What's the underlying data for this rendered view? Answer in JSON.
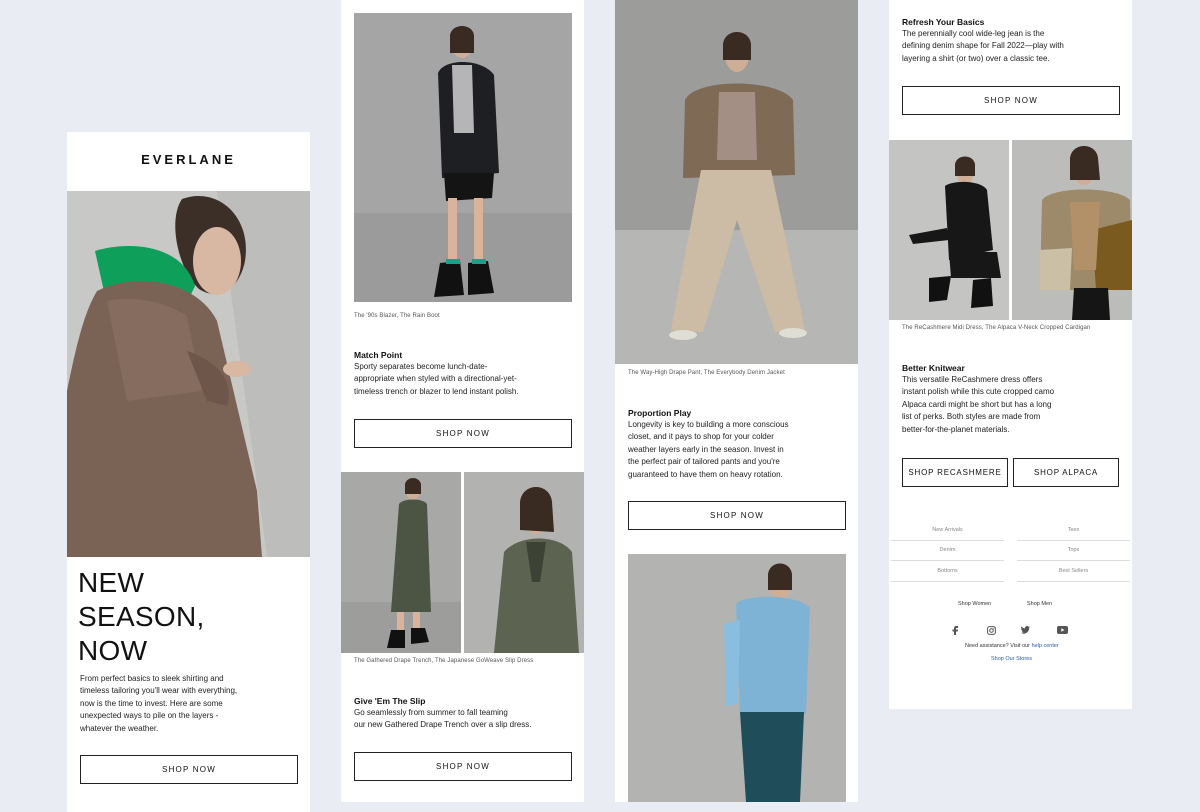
{
  "col1": {
    "logo": "EVERLANE",
    "headline": [
      "NEW",
      "SEASON,",
      "NOW"
    ],
    "intro": [
      "From perfect basics to sleek shirting and",
      "timeless tailoring you'll wear with everything,",
      "now is the time to invest. Here are some",
      "unexpected ways to pile on the layers -",
      "whatever the weather."
    ],
    "button": "SHOP NOW"
  },
  "col2": {
    "caption1": "The '90s Blazer, The Rain Boot",
    "title1": "Match Point",
    "body1": [
      "Sporty separates become lunch-date-",
      "appropriate when styled with a directional-yet-",
      "timeless trench or blazer to lend instant polish."
    ],
    "button1": "SHOP NOW",
    "caption2": "The Gathered Drape Trench, The Japanese GoWeave Slip Dress",
    "title2": "Give 'Em The Slip",
    "body2": [
      "Go seamlessly from summer to fall teaming",
      "our new Gathered Drape Trench over a slip dress."
    ],
    "button2": "SHOP NOW"
  },
  "col3": {
    "caption1": "The Way-High Drape Pant, The Everybody Denim Jacket",
    "title1": "Proportion Play",
    "body1": [
      "Longevity is key to building a more conscious",
      "closet, and it pays to shop for your colder",
      "weather layers early in the season. Invest in",
      "the perfect pair of tailored pants and you're",
      "guaranteed to have them on heavy rotation."
    ],
    "button1": "SHOP NOW"
  },
  "col4": {
    "title1": "Refresh Your Basics",
    "body1": [
      "The perennially cool wide-leg jean is the",
      "defining denim shape for Fall 2022—play with",
      "layering a shirt (or two) over a classic tee."
    ],
    "button1": "SHOP NOW",
    "caption1": "The ReCashmere Midi Dress, The Alpaca V-Neck Cropped Cardigan",
    "title2": "Better Knitwear",
    "body2": [
      "This versatile ReCashmere dress offers",
      "instant polish while this cute cropped camo",
      "Alpaca cardi might be short but has a long",
      "list of perks. Both styles are made from",
      "better-for-the-planet materials."
    ],
    "button_recashmere": "SHOP RECASHMERE",
    "button_alpaca": "SHOP ALPACA",
    "footer_links": [
      "New Arrivals",
      "Tees",
      "Denim",
      "Tops",
      "Bottoms",
      "Best Sellers"
    ],
    "shop_women": "Shop Women",
    "shop_men": "Shop Men",
    "social_icons": [
      "facebook-icon",
      "instagram-icon",
      "twitter-icon",
      "youtube-icon"
    ],
    "assist_text": "Need assistance? Visit our",
    "help_link": "help center",
    "stores_link": "Shop Our Stores"
  }
}
